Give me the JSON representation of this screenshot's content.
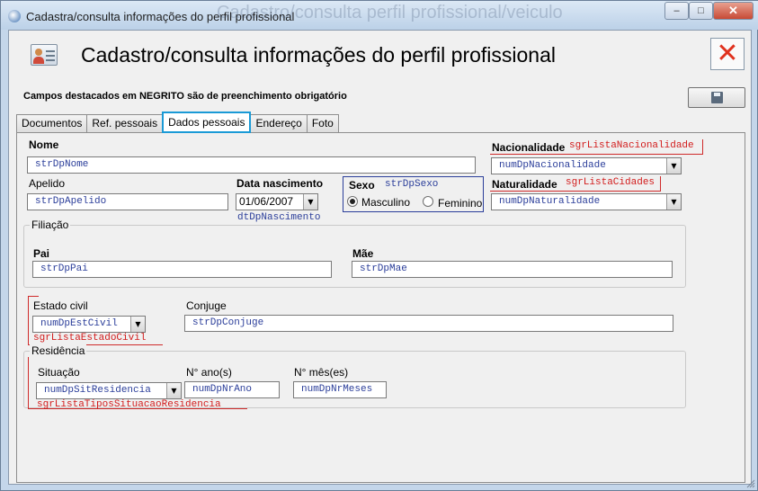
{
  "window": {
    "title": "Cadastra/consulta informações do perfil profissional",
    "ghost_title": "Cadastro/consulta perfil profissional/veiculo",
    "buttons": {
      "minimize": "–",
      "maximize": "□",
      "close": "✕"
    }
  },
  "header": {
    "title": "Cadastro/consulta informações do perfil profissional",
    "icon": "person-card-icon",
    "close_icon": "close-x-icon",
    "close_symbol": "✕"
  },
  "required_note": "Campos destacados em NEGRITO são de preenchimento obrigatório",
  "save_icon": "floppy-disk-icon",
  "tabs": [
    {
      "label": "Documentos",
      "active": false
    },
    {
      "label": "Ref. pessoais",
      "active": false
    },
    {
      "label": "Dados pessoais",
      "active": true
    },
    {
      "label": "Endereço",
      "active": false
    },
    {
      "label": "Foto",
      "active": false
    }
  ],
  "form": {
    "nome": {
      "label": "Nome",
      "value": "strDpNome"
    },
    "nacionalidade": {
      "label": "Nacionalidade",
      "tag": "sgrListaNacionalidade",
      "value": "numDpNacionalidade"
    },
    "apelido": {
      "label": "Apelido",
      "value": "strDpApelido"
    },
    "data_nascimento": {
      "label": "Data nascimento",
      "value": "01/06/2007",
      "tag": "dtDpNascimento"
    },
    "sexo": {
      "label": "Sexo",
      "tag": "strDpSexo",
      "options": [
        "Masculino",
        "Feminino"
      ],
      "selected": "Masculino"
    },
    "naturalidade": {
      "label": "Naturalidade",
      "tag": "sgrListaCidades",
      "value": "numDpNaturalidade"
    },
    "filiacao": {
      "legend": "Filiação",
      "pai": {
        "label": "Pai",
        "value": "strDpPai"
      },
      "mae": {
        "label": "Mãe",
        "value": "strDpMae"
      }
    },
    "estado_civil": {
      "label": "Estado civil",
      "value": "numDpEstCivil",
      "tag": "sgrListaEstadoCivil"
    },
    "conjuge": {
      "label": "Conjuge",
      "value": "strDpConjuge"
    },
    "residencia": {
      "legend": "Residência",
      "situacao": {
        "label": "Situação",
        "value": "numDpSitResidencia",
        "tag": "sgrListaTiposSituacaoResidencia"
      },
      "nr_ano": {
        "label": "N° ano(s)",
        "value": "numDpNrAno"
      },
      "nr_meses": {
        "label": "N° mês(es)",
        "value": "numDpNrMeses"
      }
    }
  },
  "colors": {
    "accent_tab": "#1a9ad6",
    "required_tag": "#d21c1c",
    "field_text": "#2b3e9a",
    "close_x": "#e0321e"
  }
}
